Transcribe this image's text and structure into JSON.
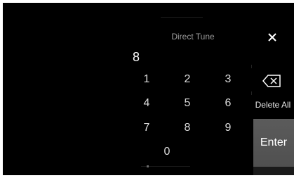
{
  "dialog": {
    "title": "Direct Tune",
    "entered_value": "8"
  },
  "keypad": {
    "keys": [
      "1",
      "2",
      "3",
      "4",
      "5",
      "6",
      "7",
      "8",
      "9",
      "0"
    ]
  },
  "actions": {
    "delete_all_label": "Delete All",
    "enter_label": "Enter",
    "close_icon": "close-icon",
    "backspace_icon": "backspace-icon"
  },
  "colors": {
    "background": "#000000",
    "key_text": "#dcdcdc",
    "title_text": "#9a9a9a",
    "enter_button": "#555555"
  }
}
